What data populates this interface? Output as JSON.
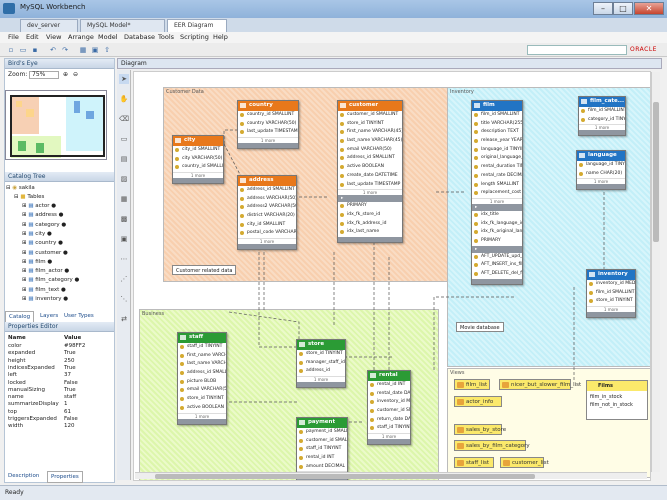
{
  "window": {
    "title": "MySQL Workbench"
  },
  "tabs": [
    {
      "label": "dev_server"
    },
    {
      "label": "MySQL Model* (sakila.mwb)"
    },
    {
      "label": "EER Diagram"
    }
  ],
  "menu": [
    "File",
    "Edit",
    "View",
    "Arrange",
    "Model",
    "Database",
    "Tools",
    "Scripting",
    "Help"
  ],
  "oracle": "ORACLE",
  "panels": {
    "birdseye": "Bird's Eye",
    "zoom_label": "Zoom:",
    "zoom_value": "75%",
    "catalog": "Catalog Tree",
    "diagram": "Diagram"
  },
  "tree": {
    "schema": "sakila",
    "tables_label": "Tables",
    "items": [
      "actor",
      "address",
      "category",
      "city",
      "country",
      "customer",
      "film",
      "film_actor",
      "film_category",
      "film_text",
      "inventory"
    ]
  },
  "prop_tabs": [
    "Catalog",
    "Layers",
    "User Types"
  ],
  "props": {
    "header": "Properties Editor",
    "col_name": "Name",
    "col_value": "Value",
    "rows": [
      [
        "color",
        "#98FF2"
      ],
      [
        "expanded",
        "True"
      ],
      [
        "height",
        "250"
      ],
      [
        "indicesExpanded",
        "True"
      ],
      [
        "left",
        "37"
      ],
      [
        "locked",
        "False"
      ],
      [
        "manualSizing",
        "True"
      ],
      [
        "name",
        "staff"
      ],
      [
        "summarizeDisplay",
        "1"
      ],
      [
        "top",
        "61"
      ],
      [
        "triggersExpanded",
        "False"
      ],
      [
        "width",
        "120"
      ]
    ]
  },
  "bottom_tabs": [
    "Description",
    "Properties"
  ],
  "status": "Ready",
  "layers": [
    {
      "name": "Customer Data",
      "color": "#f8c9a6"
    },
    {
      "name": "Inventory",
      "color": "#bfeef8"
    },
    {
      "name": "Business",
      "color": "#d9f5a8"
    },
    {
      "name": "Views",
      "color": "#fffde0"
    }
  ],
  "notes": [
    "Customer related data",
    "Movie database"
  ],
  "tables": {
    "country": {
      "title": "country",
      "cols": [
        "country_id SMALLINT",
        "country VARCHAR(50)",
        "last_update TIMESTAMP"
      ]
    },
    "city": {
      "title": "city",
      "cols": [
        "city_id SMALLINT",
        "city VARCHAR(50)",
        "country_id SMALLINT"
      ]
    },
    "address": {
      "title": "address",
      "cols": [
        "address_id SMALLINT",
        "address VARCHAR(50)",
        "address2 VARCHAR(50)",
        "district VARCHAR(20)",
        "city_id SMALLINT",
        "postal_code VARCHAR(10)"
      ]
    },
    "customer": {
      "title": "customer",
      "cols": [
        "customer_id SMALLINT",
        "store_id TINYINT",
        "first_name VARCHAR(45)",
        "last_name VARCHAR(45)",
        "email VARCHAR(50)",
        "address_id SMALLINT",
        "active BOOLEAN",
        "create_date DATETIME",
        "last_update TIMESTAMP"
      ],
      "idx": [
        "PRIMARY",
        "idx_fk_store_id",
        "idx_fk_address_id",
        "idx_last_name"
      ]
    },
    "film": {
      "title": "film",
      "cols": [
        "film_id SMALLINT",
        "title VARCHAR(255)",
        "description TEXT",
        "release_year YEAR",
        "language_id TINYINT",
        "original_language_id",
        "rental_duration TINYINT",
        "rental_rate DECIMAL",
        "length SMALLINT",
        "replacement_cost DECIMAL"
      ],
      "idx": [
        "idx_title",
        "idx_fk_language_id",
        "idx_fk_original_language",
        "PRIMARY"
      ],
      "trig": [
        "AFT_UPDATE_upd_film",
        "AFT_INSERT_ins_film",
        "AFT_DELETE_del_film"
      ]
    },
    "film_category": {
      "title": "film_cate...",
      "cols": [
        "film_id SMALLINT",
        "category_id TINYINT"
      ]
    },
    "language": {
      "title": "language",
      "cols": [
        "language_id TINYINT",
        "name CHAR(20)"
      ]
    },
    "inventory": {
      "title": "inventory",
      "cols": [
        "inventory_id MEDIUMINT",
        "film_id SMALLINT",
        "store_id TINYINT"
      ]
    },
    "staff": {
      "title": "staff",
      "cols": [
        "staff_id TINYINT",
        "first_name VARCHAR",
        "last_name VARCHAR",
        "address_id SMALLINT",
        "picture BLOB",
        "email VARCHAR(50)",
        "store_id TINYINT",
        "active BOOLEAN"
      ]
    },
    "store": {
      "title": "store",
      "cols": [
        "store_id TINYINT",
        "manager_staff_id",
        "address_id"
      ]
    },
    "payment": {
      "title": "payment",
      "cols": [
        "payment_id SMALLINT",
        "customer_id SMALLINT",
        "staff_id TINYINT",
        "rental_id INT",
        "amount DECIMAL"
      ]
    },
    "rental": {
      "title": "rental",
      "cols": [
        "rental_id INT",
        "rental_date DATETIME",
        "inventory_id MEDIUMINT",
        "customer_id SMALLINT",
        "return_date DATETIME",
        "staff_id TINYINT"
      ]
    }
  },
  "more_label": "1 more",
  "views": [
    "film_list",
    "nicer_but_slower_film_list",
    "actor_info",
    "sales_by_store",
    "sales_by_film_category",
    "staff_list",
    "customer_list"
  ],
  "film_view": {
    "title": "Films",
    "lines": [
      "film_in_stock",
      "film_not_in_stock"
    ]
  }
}
